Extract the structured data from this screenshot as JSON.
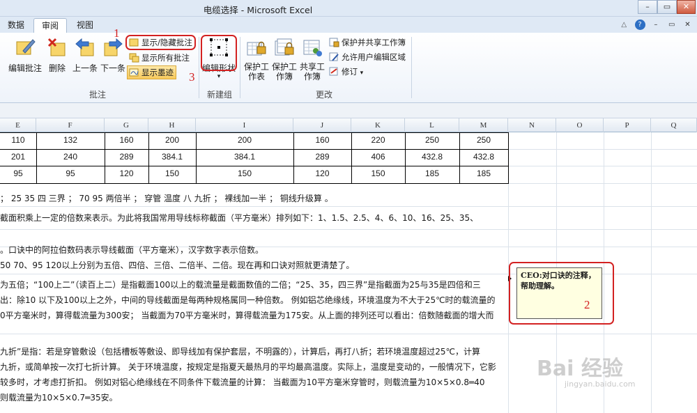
{
  "window": {
    "title": "电缆选择 - Microsoft Excel",
    "minimize": "–",
    "restore": "▭",
    "close": "✕"
  },
  "tabs": [
    {
      "label": "数据",
      "active": false
    },
    {
      "label": "审阅",
      "active": true
    },
    {
      "label": "视图",
      "active": false
    }
  ],
  "help": {
    "caret": "△",
    "question": "?",
    "min": "–",
    "restore": "▭",
    "close": "✕"
  },
  "ribbon": {
    "comments_group": {
      "label": "批注",
      "edit_comment": "编辑批注",
      "delete": "删除",
      "previous": "上一条",
      "next": "下一条",
      "show_hide_comment": "显示/隐藏批注",
      "show_all_comments": "显示所有批注",
      "show_ink": "显示墨迹"
    },
    "new_group": {
      "label": "新建组",
      "edit_shape": "编辑形状",
      "dropdown": "▾"
    },
    "changes_group": {
      "label": "更改",
      "protect_sheet": "保护工作表",
      "protect_workbook": "保护工作簿",
      "share_workbook": "共享工作簿",
      "protect_and_share": "保护并共享工作簿",
      "allow_users_edit": "允许用户编辑区域",
      "track_changes": "修订",
      "track_changes_arrow": "▾"
    }
  },
  "annotations": {
    "n1": "1",
    "n2": "2",
    "n3": "3"
  },
  "columns": [
    "E",
    "F",
    "G",
    "H",
    "I",
    "J",
    "K",
    "L",
    "M",
    "N",
    "O",
    "P",
    "Q"
  ],
  "table": {
    "rows": [
      [
        "110",
        "132",
        "160",
        "200",
        "200",
        "160",
        "220",
        "250",
        "250"
      ],
      [
        "201",
        "240",
        "289",
        "384.1",
        "384.1",
        "289",
        "406",
        "432.8",
        "432.8"
      ],
      [
        "95",
        "95",
        "120",
        "150",
        "150",
        "120",
        "150",
        "185",
        "185"
      ]
    ]
  },
  "text_lines": [
    "；  25  35  四  三界  ；  70  95  两倍半  ；  穿管  温度  八  九折  ；  裸线加一半  ；  铜线升级算  。",
    "截面积乘上一定的倍数来表示。为此将我国常用导线标称截面（平方毫米）排列如下：1、1.5、2.5、4、6、10、16、25、35、",
    "。口诀中的阿拉伯数码表示导线截面（平方毫米），汉字数字表示倍数。",
    "50  70、95    120以上分别为五倍、四倍、三倍、二倍半、二倍。现在再和口诀对照就更清楚了。",
    "为五倍；“100上二”（读百上二）是指截面100以上的载流量是截面数值的二倍；“25、35，四三界”是指截面为25与35是四倍和三",
    "出：除10 以下及100以上之外，中间的导线截面是每两种规格属同一种倍数。 例如铝芯绝缘线，环境温度为不大于25℃时的载流量的",
    "0平方毫米时，算得载流量为300安； 当截面为70平方毫米时，算得载流量为175安。从上面的排列还可以看出：倍数随截面的增大而",
    "九折”是指：若是穿管敷设（包括槽板等敷设、即导线加有保护套层，不明露的），计算后，再打八折；若环境温度超过25℃，计算",
    "九折，或简单按一次打七折计算。 关于环境温度，按规定是指夏天最热月的平均最高温度。实际上，温度是变动的，一般情况下，它影",
    "较多时，才考虑打折扣。   例如对铝心绝缘线在不同条件下载流量的计算：  当截面为10平方毫米穿管时，则载流量为10×5×0.8═40",
    "则载流量为10×5×0.7═35安。"
  ],
  "comment": {
    "text": "CEO:对口诀的注释，帮助理解。"
  },
  "watermark": {
    "main": "Bai 经验",
    "sub": "jingyan.baidu.com"
  }
}
